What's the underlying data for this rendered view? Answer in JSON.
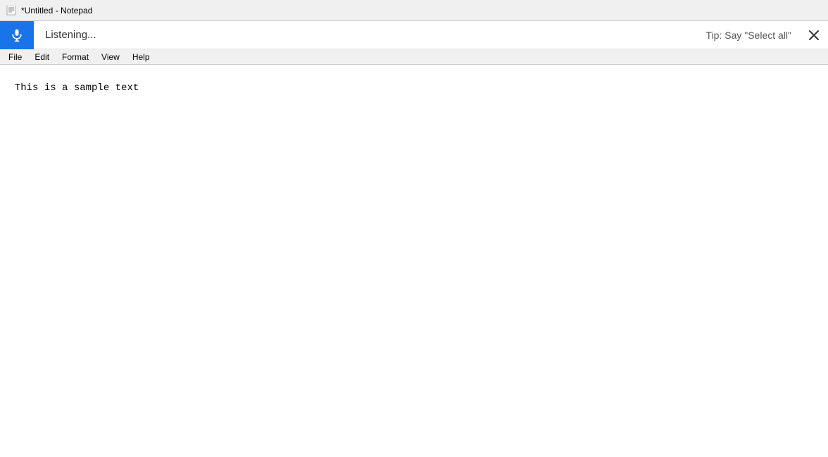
{
  "titleBar": {
    "title": "*Untitled - Notepad",
    "iconAlt": "notepad-icon"
  },
  "voiceBar": {
    "listeningText": "Listening...",
    "tipText": "Tip: Say \"Select all\"",
    "micIconName": "microphone-icon",
    "closeIconName": "close-icon"
  },
  "menuBar": {
    "items": [
      {
        "label": "File",
        "id": "menu-file"
      },
      {
        "label": "Edit",
        "id": "menu-edit"
      },
      {
        "label": "Format",
        "id": "menu-format"
      },
      {
        "label": "View",
        "id": "menu-view"
      },
      {
        "label": "Help",
        "id": "menu-help"
      }
    ]
  },
  "editor": {
    "content": "This is a sample text"
  }
}
